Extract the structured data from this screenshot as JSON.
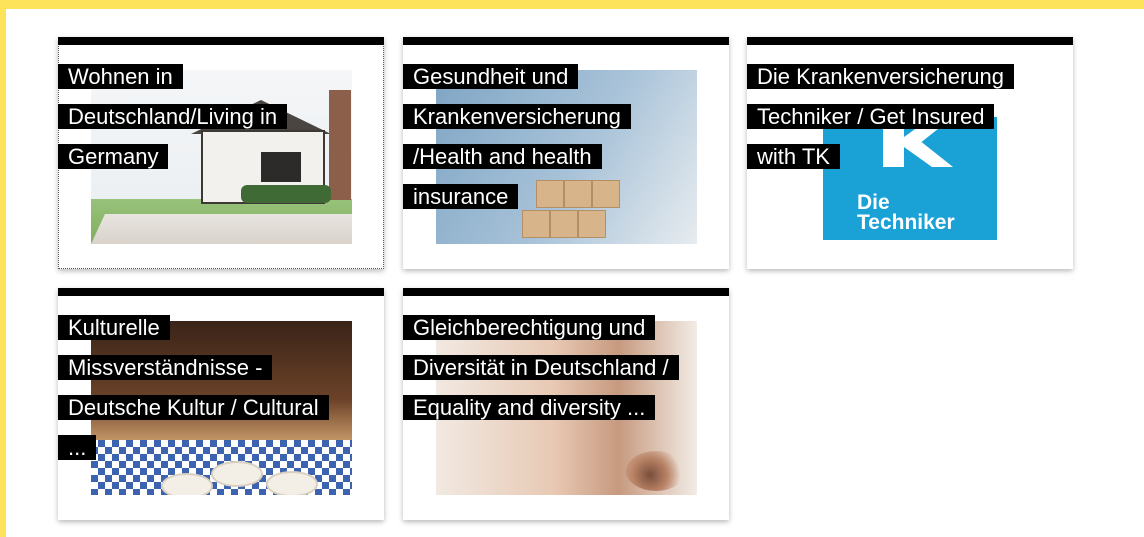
{
  "colors": {
    "accent_yellow": "#fde35a",
    "title_bg": "#000000",
    "title_text": "#ffffff",
    "techniker_blue": "#1aa1d6"
  },
  "cards": [
    {
      "title_lines": [
        "Wohnen in",
        "Deutschland/Living in",
        "Germany"
      ],
      "image": "house-photo"
    },
    {
      "title_lines": [
        "Gesundheit und",
        "Krankenversicherung",
        "/Health and health",
        "insurance"
      ],
      "image": "health-blocks-photo"
    },
    {
      "title_lines": [
        "Die Krankenversicherung",
        "Techniker / Get Insured",
        "with TK"
      ],
      "image": "techniker-logo",
      "logo_text_line1": "Die",
      "logo_text_line2": "Techniker"
    },
    {
      "title_lines": [
        "Kulturelle",
        "Missverständnisse -",
        "Deutsche Kultur / Cultural",
        "..."
      ],
      "image": "beer-garden-photo"
    },
    {
      "title_lines": [
        "Gleichberechtigung und",
        "Diversität in Deutschland /",
        "Equality and diversity ..."
      ],
      "image": "faces-closeup-photo"
    }
  ]
}
